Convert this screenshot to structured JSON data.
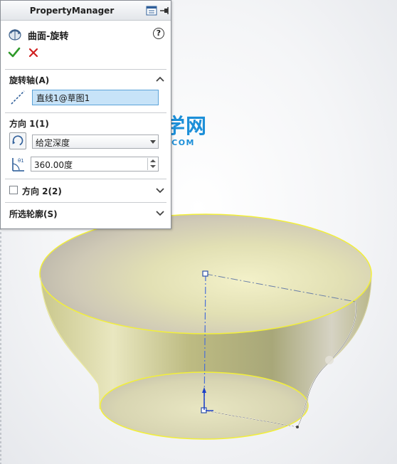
{
  "panel": {
    "title": "PropertyManager",
    "feature_name": "曲面-旋转",
    "help_label": "?"
  },
  "axis_group": {
    "title": "旋转轴(A)",
    "selection": "直线1@草图1"
  },
  "direction1": {
    "title": "方向 1(1)",
    "end_condition": "给定深度",
    "angle": "360.00度"
  },
  "direction2": {
    "title": "方向 2(2)",
    "checked": false
  },
  "contours_group": {
    "title": "所选轮廓(S)"
  },
  "watermark": {
    "title": "软件自学网",
    "url": "WWW.RJZXW.COM"
  },
  "colors": {
    "surface": "#d9d79e",
    "edge_highlight": "#f2ef3a",
    "axis_line": "#4a6fd6",
    "watermark": "#1c8fd8"
  }
}
